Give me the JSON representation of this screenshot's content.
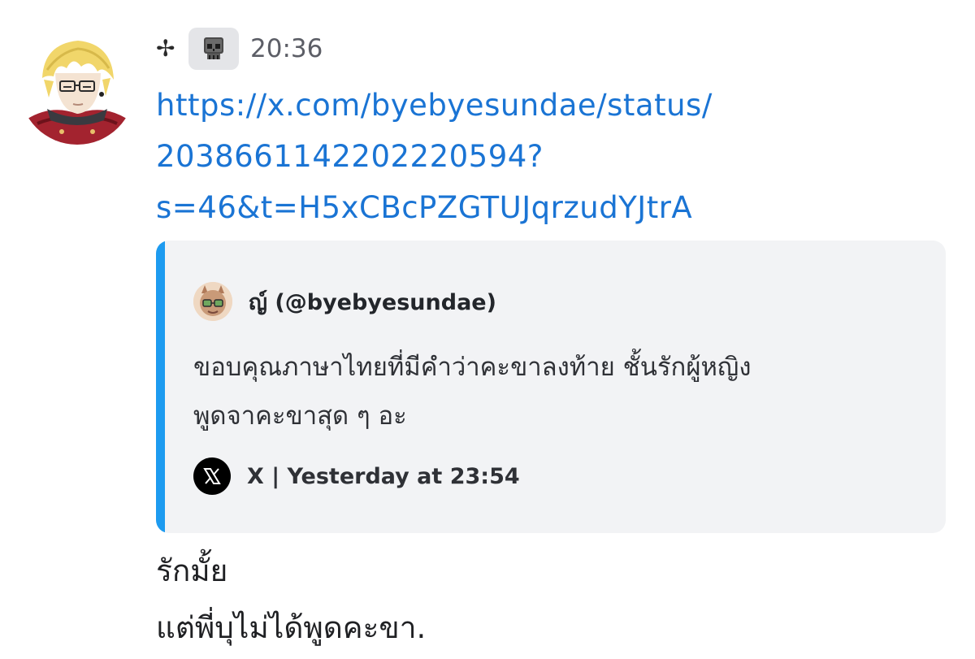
{
  "message": {
    "header": {
      "cross_glyph": "✢",
      "role_icon": "skull-icon",
      "timestamp": "20:36"
    },
    "link_lines": [
      "https://x.com/byebyesundae/status/",
      "2038661142202220594?",
      "s=46&t=H5xCBcPZGTUJqrzudYJtrA"
    ],
    "embed": {
      "accent_color": "#1d9bf0",
      "author": "ญ์ (@byebyesundae)",
      "description_lines": [
        "ขอบคุณภาษาไทยที่มีคำว่าคะขาลงท้าย ชั้นรักผู้หญิง",
        "พูดจาคะขาสุด ๆ อะ"
      ],
      "footer_icon": "x-logo-icon",
      "footer": "X | Yesterday at 23:54"
    },
    "content_lines": [
      "รักมั้ย",
      "แต่พี่บุไม่ได้พูดคะขา."
    ]
  },
  "colors": {
    "link": "#1a74d4",
    "background": "#ffffff",
    "embed_background": "#f2f3f5"
  }
}
